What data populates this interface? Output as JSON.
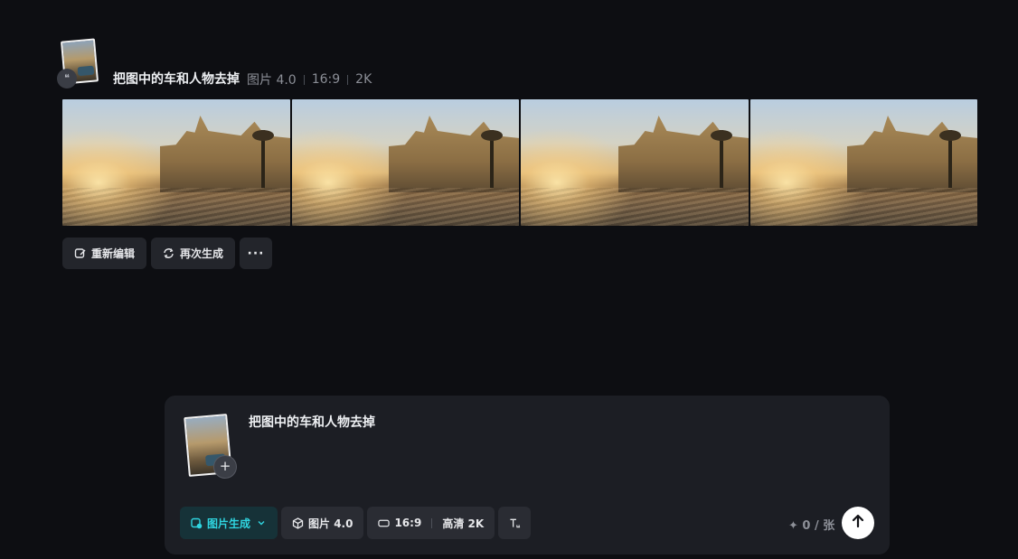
{
  "task": {
    "prompt": "把图中的车和人物去掉",
    "model": "图片 4.0",
    "ratio": "16:9",
    "resolution": "2K"
  },
  "gallery": {
    "count": 4
  },
  "actions": {
    "reedit_label": "重新编辑",
    "regenerate_label": "再次生成",
    "more_label": "···"
  },
  "composer": {
    "prompt": "把图中的车和人物去掉",
    "add_label": "+",
    "mode_label": "图片生成",
    "model_label": "图片 4.0",
    "ratio_label": "16:9",
    "quality_label": "高清 2K",
    "credit_label": "✦ 0 / 张"
  },
  "colors": {
    "accent": "#2fd5e0",
    "background": "#0d0e12",
    "panel": "#1c1e24"
  }
}
